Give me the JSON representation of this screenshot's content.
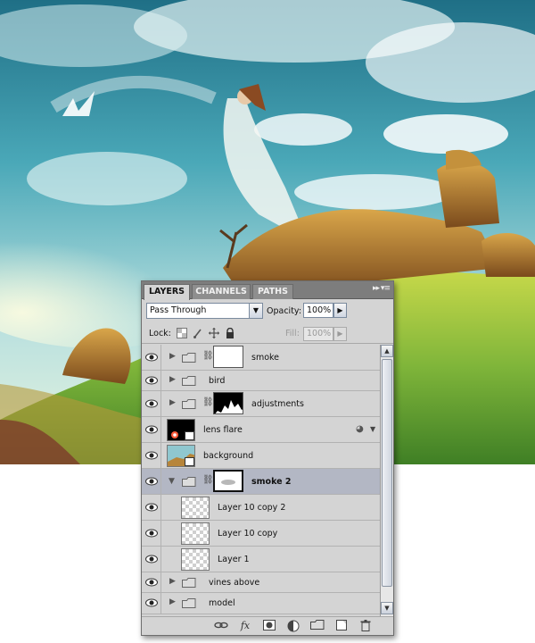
{
  "tabs": [
    {
      "label": "LAYERS",
      "active": true
    },
    {
      "label": "CHANNELS",
      "active": false
    },
    {
      "label": "PATHS",
      "active": false
    }
  ],
  "panel_menu": {
    "label": "▸▸ ▾≡"
  },
  "blend": {
    "mode": "Pass Through",
    "arrow": "▼"
  },
  "opacity": {
    "label": "Opacity:",
    "value": "100%",
    "arrow": "▶"
  },
  "lock": {
    "label": "Lock:",
    "icons": [
      "transparent-lock-icon",
      "brush-lock-icon",
      "move-lock-icon",
      "padlock-icon"
    ]
  },
  "fill": {
    "label": "Fill:",
    "value": "100%",
    "arrow": "▶"
  },
  "layers": [
    {
      "name": "smoke",
      "kind": "group",
      "mask": "white",
      "visible": true,
      "expanded": false
    },
    {
      "name": "bird",
      "kind": "group",
      "visible": true,
      "expanded": false
    },
    {
      "name": "adjustments",
      "kind": "group",
      "mask": "mountain",
      "visible": true,
      "expanded": false
    },
    {
      "name": "lens flare",
      "kind": "smart",
      "visible": true
    },
    {
      "name": "background",
      "kind": "smart",
      "visible": true
    },
    {
      "name": "smoke 2",
      "kind": "group",
      "mask": "smudge",
      "visible": true,
      "expanded": true,
      "selected": true
    },
    {
      "name": "Layer 10 copy 2",
      "kind": "pixel",
      "visible": true,
      "indent": true
    },
    {
      "name": "Layer 10 copy",
      "kind": "pixel",
      "visible": true,
      "indent": true
    },
    {
      "name": "Layer 1",
      "kind": "pixel",
      "visible": true,
      "indent": true
    },
    {
      "name": "vines above",
      "kind": "group",
      "visible": true,
      "expanded": false
    },
    {
      "name": "model",
      "kind": "group",
      "visible": true,
      "expanded": false
    }
  ],
  "bottom_icons": [
    "link-layers-icon",
    "fx-icon",
    "add-mask-icon",
    "adjustment-layer-icon",
    "new-group-icon",
    "new-layer-icon",
    "trash-icon"
  ],
  "bottom_glyphs": {
    "fx": "fx"
  },
  "colors": {
    "panel": "#d4d4d4",
    "tabbar": "#7d7d7d",
    "selected_row": "#b3b7c4"
  }
}
